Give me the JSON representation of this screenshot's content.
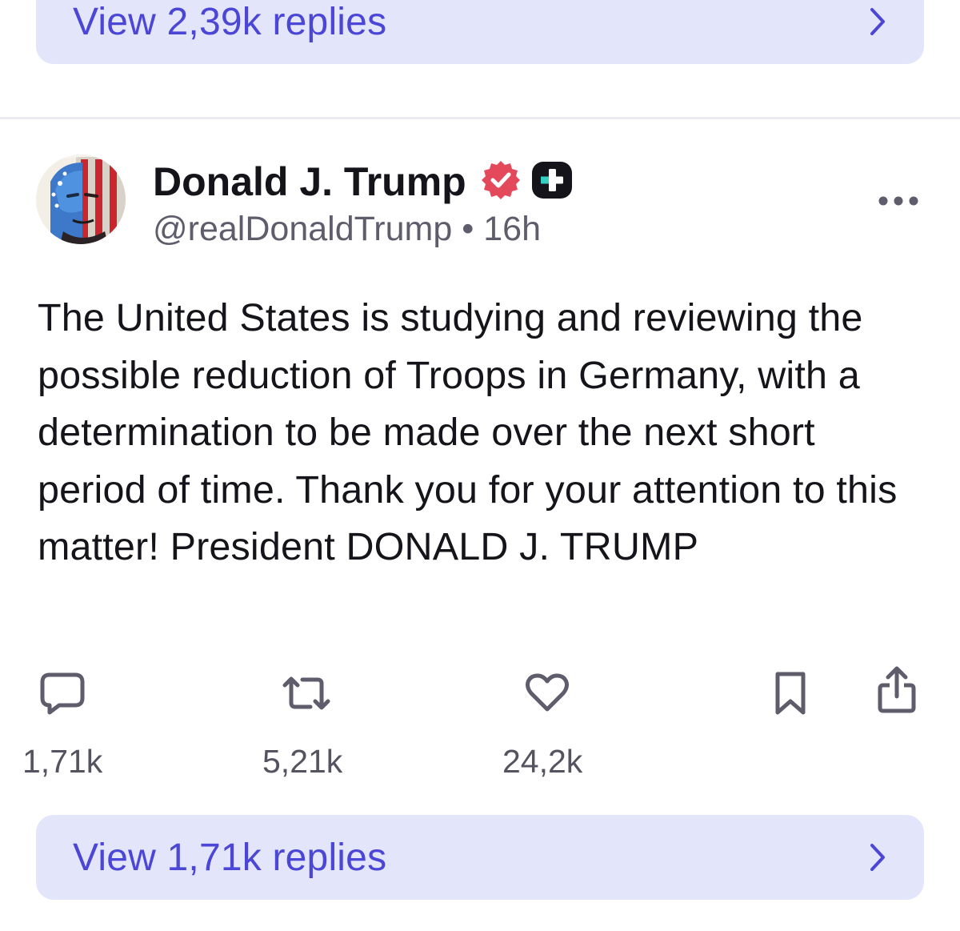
{
  "prev_post": {
    "view_replies_label": "View 2,39k replies"
  },
  "post": {
    "author_name": "Donald J. Trump",
    "handle": "@realDonaldTrump",
    "separator": "•",
    "time": "16h",
    "text": "The United States is studying and reviewing the possible reduction of Troops in Germany, with a determination to be made over the next short period of time. Thank you for your attention to this matter! President DONALD J. TRUMP",
    "actions": {
      "reply_count": "1,71k",
      "repost_count": "5,21k",
      "like_count": "24,2k"
    },
    "view_replies_label": "View 1,71k replies"
  },
  "icons": {
    "verified": "verified-badge-icon",
    "plus_badge": "plus-badge-icon",
    "more": "more-icon",
    "reply": "reply-icon",
    "repost": "repost-icon",
    "like": "heart-icon",
    "bookmark": "bookmark-icon",
    "share": "share-icon",
    "chevron": "chevron-right-icon"
  },
  "colors": {
    "accent": "#4b46d6",
    "button_bg": "#e3e5fb",
    "verified": "#e3495b",
    "icon_gray": "#5f5d6c",
    "text": "#15141a"
  }
}
